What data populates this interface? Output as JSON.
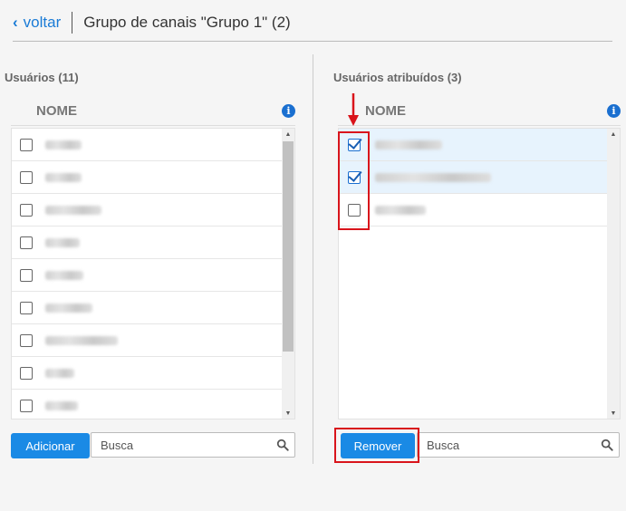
{
  "header": {
    "back_label": "voltar",
    "title": "Grupo de canais \"Grupo 1\" (2)"
  },
  "left_panel": {
    "title": "Usuários (11)",
    "column_header": "NOME",
    "add_button": "Adicionar",
    "search_placeholder": "Busca",
    "rows": [
      {
        "checked": false
      },
      {
        "checked": false
      },
      {
        "checked": false
      },
      {
        "checked": false
      },
      {
        "checked": false
      },
      {
        "checked": false
      },
      {
        "checked": false
      },
      {
        "checked": false
      },
      {
        "checked": false
      }
    ]
  },
  "right_panel": {
    "title": "Usuários atribuídos (3)",
    "column_header": "NOME",
    "remove_button": "Remover",
    "search_placeholder": "Busca",
    "rows": [
      {
        "checked": true
      },
      {
        "checked": true
      },
      {
        "checked": false
      }
    ]
  },
  "colors": {
    "accent": "#1a8ae5",
    "highlight": "#d9141b",
    "selected_row": "#e7f3fd"
  }
}
